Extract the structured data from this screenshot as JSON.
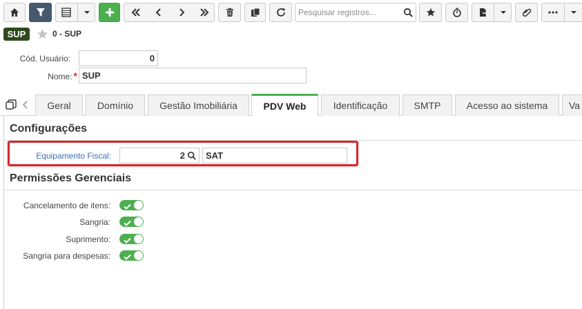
{
  "toolbar": {
    "search_placeholder": "Pesquisar registros...",
    "icons": [
      "home-icon",
      "filter-icon",
      "grid-view-icon",
      "chevron-down-icon",
      "add-icon",
      "first-record-icon",
      "previous-record-icon",
      "next-record-icon",
      "last-record-icon",
      "delete-icon",
      "copy-icon",
      "refresh-icon",
      "search-icon",
      "favorite-star-icon",
      "timer-icon",
      "export-file-icon",
      "chevron-down-icon",
      "attachment-icon",
      "more-options-icon",
      "chevron-down-icon"
    ]
  },
  "record": {
    "badge": "SUP",
    "title": "0 - SUP"
  },
  "form": {
    "cod_usuario_label": "Cód. Usuário:",
    "cod_usuario_value": "0",
    "nome_label": "Nome:",
    "nome_required": "*",
    "nome_value": "SUP"
  },
  "tabs": [
    {
      "label": "Geral",
      "active": false
    },
    {
      "label": "Domínio",
      "active": false
    },
    {
      "label": "Gestão Imobiliária",
      "active": false
    },
    {
      "label": "PDV Web",
      "active": true
    },
    {
      "label": "Identificação",
      "active": false
    },
    {
      "label": "SMTP",
      "active": false
    },
    {
      "label": "Acesso ao sistema",
      "active": false
    },
    {
      "label": "Va",
      "active": false
    }
  ],
  "pdv": {
    "configuracoes_title": "Configurações",
    "equipamento_label": "Equipamento Fiscal:",
    "equipamento_code": "2",
    "equipamento_desc": "SAT",
    "permissoes_title": "Permissões Gerenciais",
    "permissions": [
      {
        "label": "Cancelamento de itens:",
        "enabled": true
      },
      {
        "label": "Sangria:",
        "enabled": true
      },
      {
        "label": "Suprimento:",
        "enabled": true
      },
      {
        "label": "Sangria para despesas:",
        "enabled": true
      }
    ]
  },
  "colors": {
    "accent_green": "#4caf50",
    "toolbar_dark": "#455a6e",
    "badge_bg": "#2e4a1e",
    "highlight_red": "#d9272e",
    "link_blue": "#3a6fb5"
  }
}
